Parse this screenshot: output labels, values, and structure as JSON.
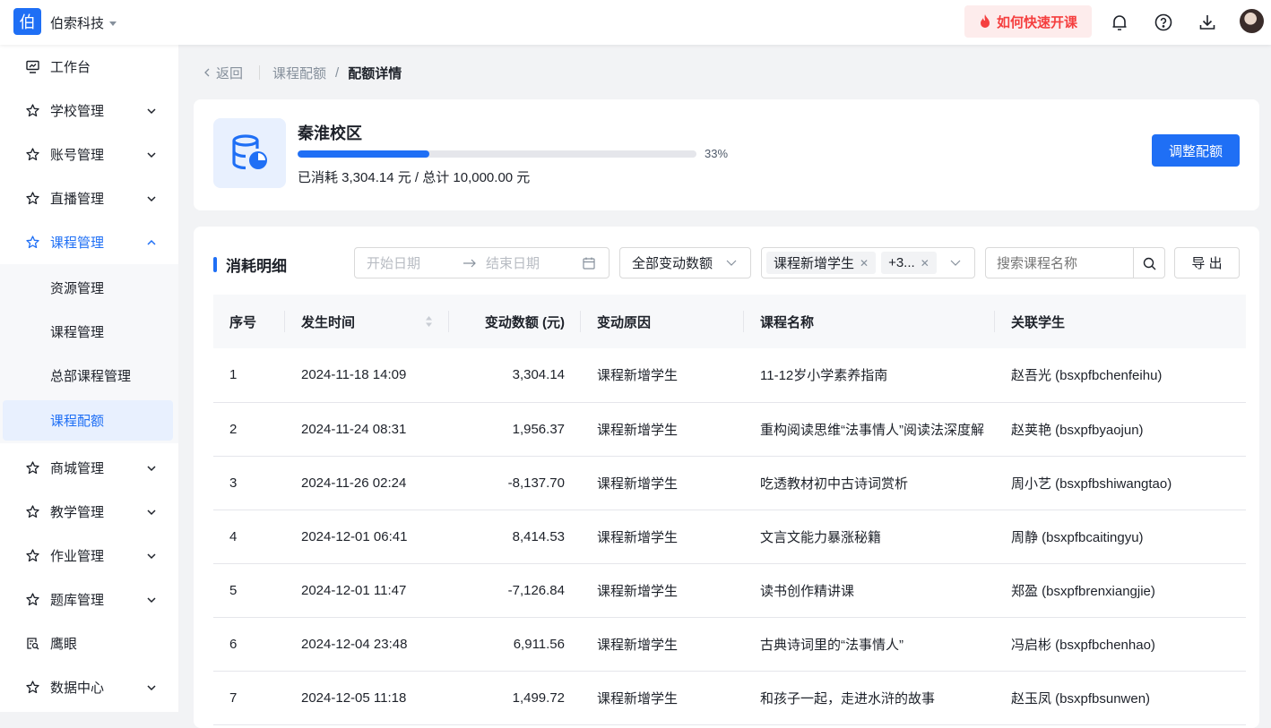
{
  "topbar": {
    "logo_char": "伯",
    "brand": "伯索科技",
    "promo": "如何快速开课",
    "icons": [
      "bell-icon",
      "help-icon",
      "download-icon",
      "avatar"
    ]
  },
  "sidebar": {
    "items": [
      {
        "label": "工作台",
        "icon": "dashboard-icon"
      },
      {
        "label": "学校管理",
        "icon": "star-icon"
      },
      {
        "label": "账号管理",
        "icon": "star-icon"
      },
      {
        "label": "直播管理",
        "icon": "star-icon"
      },
      {
        "label": "课程管理",
        "icon": "star-icon",
        "expanded": true
      },
      {
        "label": "商城管理",
        "icon": "star-icon"
      },
      {
        "label": "教学管理",
        "icon": "star-icon"
      },
      {
        "label": "作业管理",
        "icon": "star-icon"
      },
      {
        "label": "题库管理",
        "icon": "star-icon"
      },
      {
        "label": "鹰眼",
        "icon": "eye-doc-icon"
      },
      {
        "label": "数据中心",
        "icon": "star-icon"
      }
    ],
    "sub_items": [
      "资源管理",
      "课程管理",
      "总部课程管理",
      "课程配额"
    ]
  },
  "breadcrumb": {
    "back": "返回",
    "parent": "课程配额",
    "sep": "/",
    "current": "配额详情"
  },
  "quota": {
    "campus": "秦淮校区",
    "progress": 33,
    "progress_label": "33%",
    "usage": "已消耗 3,304.14 元 / 总计 10,000.00 元",
    "adjust_button": "调整配额"
  },
  "details": {
    "title": "消耗明细",
    "start_date_placeholder": "开始日期",
    "end_date_placeholder": "结束日期",
    "change_type_select": "全部变动数额",
    "reason_tags": [
      "课程新增学生",
      "+3..."
    ],
    "search_placeholder": "搜索课程名称",
    "export_button": "导 出",
    "columns": [
      "序号",
      "发生时间",
      "变动数额 (元)",
      "变动原因",
      "课程名称",
      "关联学生"
    ],
    "rows": [
      [
        "1",
        "2024-11-18 14:09",
        "3,304.14",
        "课程新增学生",
        "11-12岁小学素养指南",
        "赵吾光 (bsxpfbchenfeihu)"
      ],
      [
        "2",
        "2024-11-24 08:31",
        "1,956.37",
        "课程新增学生",
        "重构阅读思维“法事情人”阅读法深度解",
        "赵荚艳 (bsxpfbyaojun)"
      ],
      [
        "3",
        "2024-11-26 02:24",
        "-8,137.70",
        "课程新增学生",
        "吃透教材初中古诗词赏析",
        "周小艺 (bsxpfbshiwangtao)"
      ],
      [
        "4",
        "2024-12-01 06:41",
        "8,414.53",
        "课程新增学生",
        "文言文能力暴涨秘籍",
        "周静 (bsxpfbcaitingyu)"
      ],
      [
        "5",
        "2024-12-01 11:47",
        "-7,126.84",
        "课程新增学生",
        "读书创作精讲课",
        "郑盈 (bsxpfbrenxiangjie)"
      ],
      [
        "6",
        "2024-12-04 23:48",
        "6,911.56",
        "课程新增学生",
        "古典诗词里的“法事情人”",
        "冯启彬 (bsxpfbchenhao)"
      ],
      [
        "7",
        "2024-12-05 11:18",
        "1,499.72",
        "课程新增学生",
        "和孩子一起，走进水浒的故事",
        "赵玉凤 (bsxpfbsunwen)"
      ]
    ]
  },
  "colors": {
    "primary": "#1f6ff5",
    "promo": "#f53f3f"
  }
}
